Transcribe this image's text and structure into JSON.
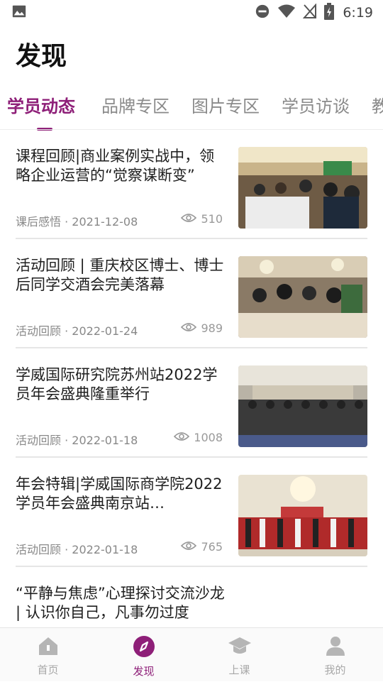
{
  "statusbar": {
    "time": "6:19"
  },
  "page": {
    "title": "发现"
  },
  "tabs": [
    {
      "label": "学员动态"
    },
    {
      "label": "品牌专区"
    },
    {
      "label": "图片专区"
    },
    {
      "label": "学员访谈"
    },
    {
      "label": "教"
    }
  ],
  "articles": [
    {
      "title": "课程回顾|商业案例实战中，领略企业运营的“觉察谋断变”",
      "category": "课后感悟",
      "date": "2021-12-08",
      "views": "510"
    },
    {
      "title": "活动回顾 | 重庆校区博士、博士后同学交酒会完美落幕",
      "category": "活动回顾",
      "date": "2022-01-24",
      "views": "989"
    },
    {
      "title": "学威国际研究院苏州站2022学员年会盛典隆重举行",
      "category": "活动回顾",
      "date": "2022-01-18",
      "views": "1008"
    },
    {
      "title": "年会特辑|学威国际商学院2022学员年会盛典南京站…",
      "category": "活动回顾",
      "date": "2022-01-18",
      "views": "765"
    },
    {
      "title": "“平静与焦虑”心理探讨交流沙龙 | 认识你自己，凡事勿过度",
      "category": "",
      "date": "",
      "views": ""
    }
  ],
  "bottom_nav": [
    {
      "label": "首页",
      "icon": "home-icon"
    },
    {
      "label": "发现",
      "icon": "compass-icon"
    },
    {
      "label": "上课",
      "icon": "graduation-cap-icon"
    },
    {
      "label": "我的",
      "icon": "person-icon"
    }
  ],
  "colors": {
    "accent": "#8e1f78",
    "inactive": "#a8a8a8"
  }
}
